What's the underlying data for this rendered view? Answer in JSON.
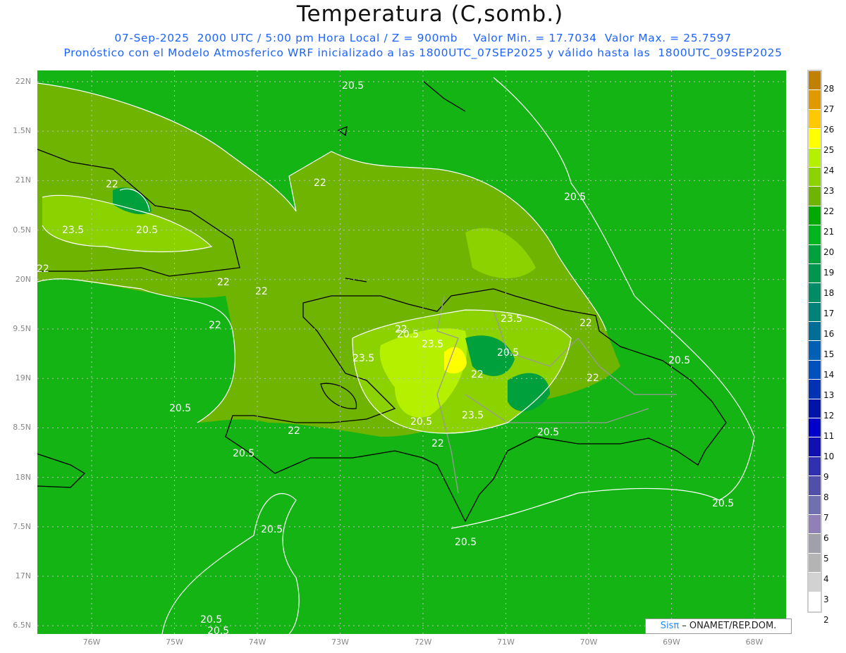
{
  "title": "Temperatura (C,somb.)",
  "subtitle1": "07-Sep-2025  2000 UTC / 5:00 pm Hora Local / Z = 900mb    Valor Min. = 17.7034  Valor Max. = 25.7597",
  "subtitle2": "Pronóstico con el Modelo Atmosferico WRF inicializado a las 1800UTC_07SEP2025 y válido hasta las  1800UTC_09SEP2025",
  "lat_ticks": [
    "22N",
    "1.5N",
    "21N",
    "0.5N",
    "20N",
    "9.5N",
    "19N",
    "8.5N",
    "18N",
    "7.5N",
    "17N",
    "6.5N"
  ],
  "lon_ticks": [
    "76W",
    "75W",
    "74W",
    "73W",
    "72W",
    "71W",
    "70W",
    "69W",
    "68W"
  ],
  "colorbar": {
    "labels": [
      "28",
      "27",
      "26",
      "25",
      "24",
      "23",
      "22",
      "21",
      "20",
      "19",
      "18",
      "17",
      "16",
      "15",
      "14",
      "13",
      "12",
      "11",
      "10",
      "9",
      "8",
      "7",
      "6",
      "5",
      "4",
      "3",
      "2"
    ],
    "colors": [
      "#c08000",
      "#e09a00",
      "#ffc800",
      "#ffff00",
      "#b4f000",
      "#8cd200",
      "#6eb400",
      "#00aa00",
      "#00b41e",
      "#00a03c",
      "#009650",
      "#008c64",
      "#008278",
      "#006e96",
      "#0060b4",
      "#0050be",
      "#0032b4",
      "#0014aa",
      "#0000c8",
      "#1010b0",
      "#3030b0",
      "#5050aa",
      "#7070b0",
      "#9080b8",
      "#a0a0aa",
      "#b4b4b4",
      "#d2d2d2",
      "#ffffff"
    ]
  },
  "contour_labels": [
    "20.5",
    "22",
    "22",
    "23.5",
    "20.5",
    "22",
    "22",
    "22",
    "22",
    "23.5",
    "22",
    "23.5",
    "23.5",
    "20.5",
    "22",
    "22",
    "20.5",
    "20.5",
    "22",
    "23.5",
    "20.5",
    "22",
    "20.5",
    "20.5",
    "20.5",
    "20.5",
    "20.5",
    "20.5",
    "20.5",
    "20.5",
    "20.5",
    "22"
  ],
  "logo": {
    "brand": "Sisπ",
    "text": " – ONAMET/REP.DOM."
  }
}
